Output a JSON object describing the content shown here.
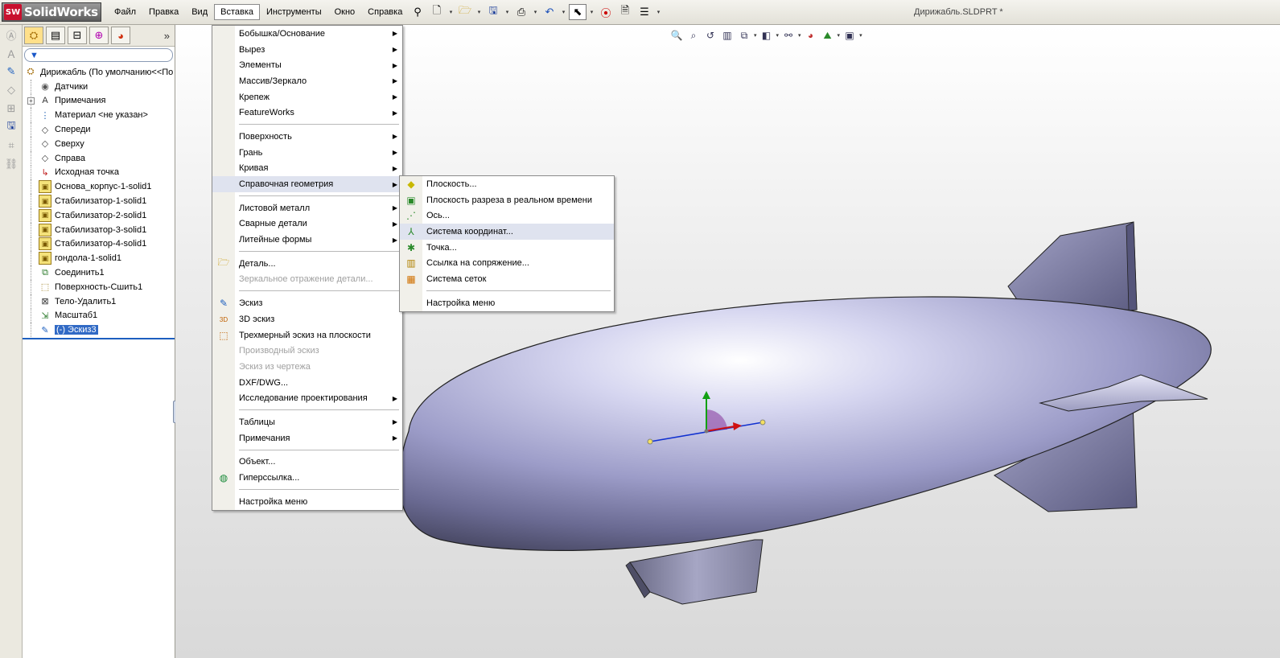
{
  "app": {
    "logo_text": "SolidWorks",
    "logo_badge": "SW",
    "doc_title": "Дирижабль.SLDPRT *"
  },
  "menubar": [
    {
      "label": "Файл",
      "active": false
    },
    {
      "label": "Правка",
      "active": false
    },
    {
      "label": "Вид",
      "active": false
    },
    {
      "label": "Вставка",
      "active": true
    },
    {
      "label": "Инструменты",
      "active": false
    },
    {
      "label": "Окно",
      "active": false
    },
    {
      "label": "Справка",
      "active": false
    }
  ],
  "toolbar_icons": [
    "pin-icon",
    "new-document-icon",
    "open-folder-icon",
    "save-icon",
    "print-icon",
    "undo-icon",
    "select-arrow-icon",
    "rebuild-traffic-light-icon",
    "file-properties-icon",
    "options-icon"
  ],
  "left_strip_icons": [
    "smart-dimension-icon",
    "note-icon",
    "open-sketch-icon",
    "reference-plane-icon",
    "component-icon",
    "save-state-icon",
    "layout-icon",
    "hyperlink-chain-icon"
  ],
  "fm_tabs": [
    "feature-manager-tab-icon",
    "property-manager-tab-icon",
    "configuration-manager-tab-icon",
    "dimxpert-tab-icon",
    "display-manager-tab-icon"
  ],
  "tree": [
    {
      "label": "Дирижабль  (По умолчанию<<По",
      "icon": "part-icon",
      "level": 0,
      "expander": false
    },
    {
      "label": "Датчики",
      "icon": "sensors-icon",
      "level": 1,
      "expander": false
    },
    {
      "label": "Примечания",
      "icon": "annotations-icon",
      "level": 1,
      "expander": true
    },
    {
      "label": "Материал <не указан>",
      "icon": "material-icon",
      "level": 1,
      "expander": false
    },
    {
      "label": "Спереди",
      "icon": "plane-icon",
      "level": 1,
      "expander": false
    },
    {
      "label": "Сверху",
      "icon": "plane-icon",
      "level": 1,
      "expander": false
    },
    {
      "label": "Справа",
      "icon": "plane-icon",
      "level": 1,
      "expander": false
    },
    {
      "label": "Исходная точка",
      "icon": "origin-icon",
      "level": 1,
      "expander": false
    },
    {
      "label": "Основа_корпус-1-solid1",
      "icon": "imported-body-icon",
      "level": 1,
      "expander": false
    },
    {
      "label": "Стабилизатор-1-solid1",
      "icon": "imported-body-icon",
      "level": 1,
      "expander": false
    },
    {
      "label": "Стабилизатор-2-solid1",
      "icon": "imported-body-icon",
      "level": 1,
      "expander": false
    },
    {
      "label": "Стабилизатор-3-solid1",
      "icon": "imported-body-icon",
      "level": 1,
      "expander": false
    },
    {
      "label": "Стабилизатор-4-solid1",
      "icon": "imported-body-icon",
      "level": 1,
      "expander": false
    },
    {
      "label": "гондола-1-solid1",
      "icon": "imported-body-icon",
      "level": 1,
      "expander": false
    },
    {
      "label": "Соединить1",
      "icon": "combine-icon",
      "level": 1,
      "expander": false
    },
    {
      "label": "Поверхность-Сшить1",
      "icon": "knit-surface-icon",
      "level": 1,
      "expander": false
    },
    {
      "label": "Тело-Удалить1",
      "icon": "delete-body-icon",
      "level": 1,
      "expander": false
    },
    {
      "label": "Масштаб1",
      "icon": "scale-icon",
      "level": 1,
      "expander": false
    },
    {
      "label": "(-) Эскиз3",
      "icon": "sketch-icon",
      "level": 1,
      "expander": false,
      "selected": true
    }
  ],
  "view_toolbar_icons": [
    "zoom-to-fit-icon",
    "zoom-area-icon",
    "previous-view-icon",
    "section-view-icon",
    "view-orientation-icon",
    "display-style-icon",
    "hide-show-items-icon",
    "edit-appearance-icon",
    "apply-scene-icon",
    "view-settings-icon"
  ],
  "insert_menu": [
    {
      "label": "Бобышка/Основание",
      "submenu": true
    },
    {
      "label": "Вырез",
      "submenu": true
    },
    {
      "label": "Элементы",
      "submenu": true
    },
    {
      "label": "Массив/Зеркало",
      "submenu": true
    },
    {
      "label": "Крепеж",
      "submenu": true
    },
    {
      "label": "FeatureWorks",
      "submenu": true
    },
    {
      "sep": true
    },
    {
      "label": "Поверхность",
      "submenu": true
    },
    {
      "label": "Грань",
      "submenu": true
    },
    {
      "label": "Кривая",
      "submenu": true
    },
    {
      "label": "Справочная геометрия",
      "submenu": true,
      "highlighted": true
    },
    {
      "sep": true
    },
    {
      "label": "Листовой металл",
      "submenu": true
    },
    {
      "label": "Сварные детали",
      "submenu": true
    },
    {
      "label": "Литейные формы",
      "submenu": true
    },
    {
      "sep": true
    },
    {
      "label": "Деталь...",
      "icon": "insert-part-icon"
    },
    {
      "label": "Зеркальное отражение детали...",
      "disabled": true
    },
    {
      "sep": true
    },
    {
      "label": "Эскиз",
      "icon": "sketch-icon"
    },
    {
      "label": "3D эскиз",
      "icon": "3d-sketch-icon"
    },
    {
      "label": "Трехмерный эскиз на плоскости",
      "icon": "3d-sketch-on-plane-icon"
    },
    {
      "label": "Производный эскиз",
      "disabled": true
    },
    {
      "label": "Эскиз из чертежа",
      "disabled": true
    },
    {
      "label": "DXF/DWG..."
    },
    {
      "label": "Исследование проектирования",
      "submenu": true
    },
    {
      "sep": true
    },
    {
      "label": "Таблицы",
      "submenu": true
    },
    {
      "label": "Примечания",
      "submenu": true
    },
    {
      "sep": true
    },
    {
      "label": "Объект..."
    },
    {
      "label": "Гиперссылка...",
      "icon": "hyperlink-globe-icon"
    },
    {
      "sep": true
    },
    {
      "label": "Настройка меню"
    }
  ],
  "ref_geometry_menu": [
    {
      "label": "Плоскость...",
      "icon": "plane-ref-icon"
    },
    {
      "label": "Плоскость разреза в реальном времени",
      "icon": "live-section-plane-icon"
    },
    {
      "label": "Ось...",
      "icon": "axis-icon"
    },
    {
      "label": "Система координат...",
      "icon": "coordinate-system-icon",
      "highlighted": true
    },
    {
      "label": "Точка...",
      "icon": "point-icon"
    },
    {
      "label": "Ссылка на сопряжение...",
      "icon": "mate-reference-icon"
    },
    {
      "label": "Система сеток",
      "icon": "grid-system-icon"
    },
    {
      "sep": true
    },
    {
      "label": "Настройка меню"
    }
  ]
}
